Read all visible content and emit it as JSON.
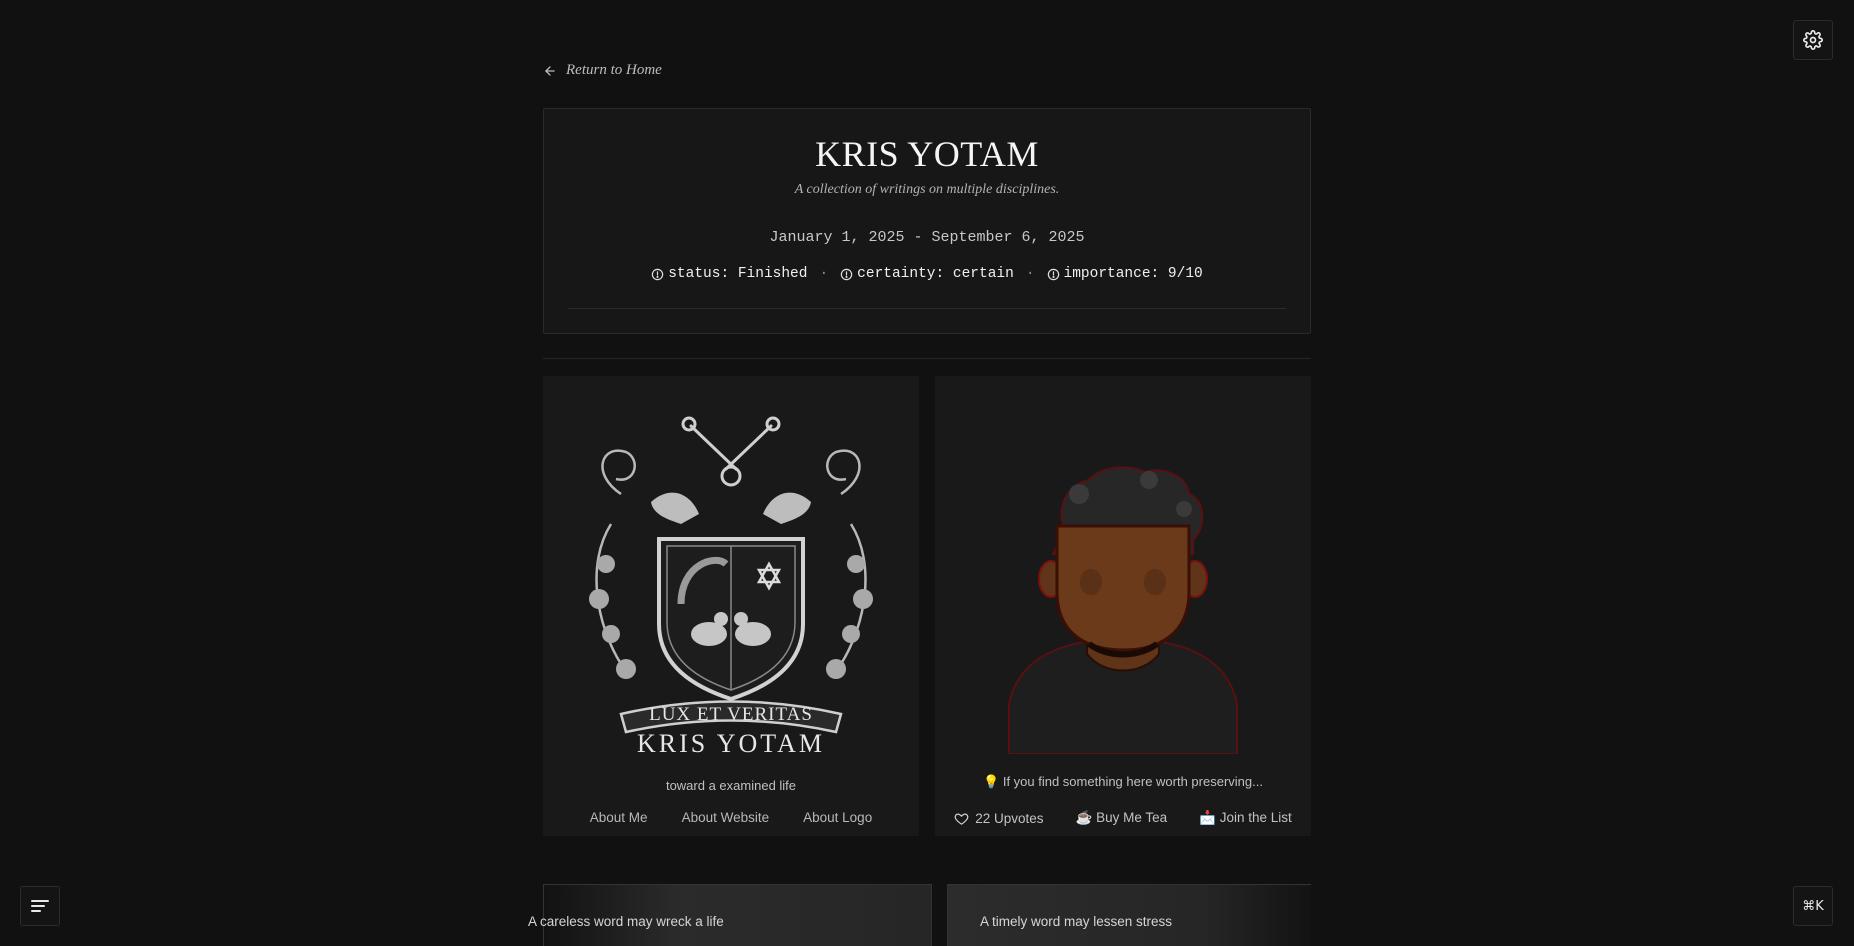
{
  "nav": {
    "back_label": "Return to Home"
  },
  "header": {
    "title": "KRIS YOTAM",
    "subtitle": "A collection of writings on multiple disciplines.",
    "dates": "January 1, 2025 - September 6, 2025",
    "meta": [
      {
        "label": "status: Finished"
      },
      {
        "label": "certainty: certain"
      },
      {
        "label": "importance: 9/10"
      }
    ]
  },
  "left_panel": {
    "crest_motto": "LUX ET VERITAS",
    "crest_name": "KRIS YOTAM",
    "tagline": "toward a examined life",
    "links": [
      "About Me",
      "About Website",
      "About Logo"
    ]
  },
  "right_panel": {
    "prompt": "💡 If you find something here worth preserving...",
    "upvotes": "22 Upvotes",
    "tea": "☕ Buy Me Tea",
    "list": "📩 Join the List"
  },
  "quotes": {
    "left": "A careless word may wreck a life",
    "right": "A timely word may lessen stress"
  },
  "shortcut": "⌘K",
  "icons": {
    "settings": "gear-icon",
    "back": "arrow-left-icon",
    "info": "info-circle-icon",
    "menu": "menu-lines-icon",
    "upvote": "heart-icon"
  },
  "colors": {
    "background": "#111111",
    "card": "#171717",
    "panel": "#191919",
    "avatar_skin": "#6a3a1a",
    "avatar_outline": "#7a1010"
  }
}
